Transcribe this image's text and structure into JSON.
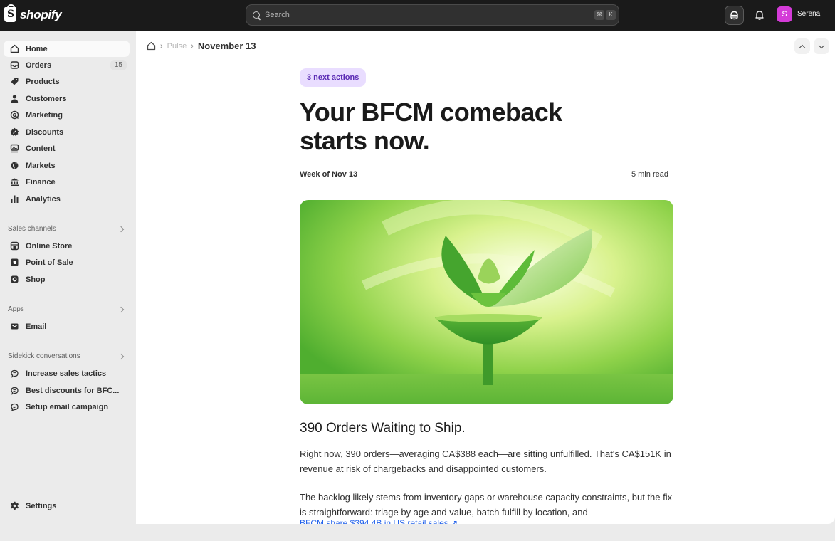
{
  "topbar": {
    "brand": "shopify",
    "search_placeholder": "Search",
    "shortcut_cmd": "⌘",
    "shortcut_key": "K",
    "user_initial": "S",
    "user_name": "Serena"
  },
  "sidebar": {
    "items": [
      {
        "label": "Home",
        "icon": "home-icon"
      },
      {
        "label": "Orders",
        "icon": "orders-icon",
        "badge": "15"
      },
      {
        "label": "Products",
        "icon": "tag-icon"
      },
      {
        "label": "Customers",
        "icon": "person-icon"
      },
      {
        "label": "Marketing",
        "icon": "target-icon"
      },
      {
        "label": "Discounts",
        "icon": "discount-icon"
      },
      {
        "label": "Content",
        "icon": "content-icon"
      },
      {
        "label": "Markets",
        "icon": "globe-icon"
      },
      {
        "label": "Finance",
        "icon": "bank-icon"
      },
      {
        "label": "Analytics",
        "icon": "bar-chart-icon"
      }
    ],
    "sales_channels": {
      "heading": "Sales channels",
      "items": [
        {
          "label": "Online Store",
          "icon": "store-icon"
        },
        {
          "label": "Point of Sale",
          "icon": "pos-icon"
        },
        {
          "label": "Shop",
          "icon": "shop-icon"
        }
      ]
    },
    "apps": {
      "heading": "Apps",
      "items": [
        {
          "label": "Email",
          "icon": "email-icon"
        }
      ]
    },
    "sidekick": {
      "heading": "Sidekick conversations",
      "items": [
        {
          "label": "Increase sales tactics",
          "icon": "chat-icon"
        },
        {
          "label": "Best discounts for BFC...",
          "icon": "chat-icon"
        },
        {
          "label": "Setup email campaign",
          "icon": "chat-icon"
        }
      ]
    },
    "settings_label": "Settings"
  },
  "breadcrumb": {
    "parent": "Pulse",
    "current": "November 13"
  },
  "article": {
    "pill": "3 next actions",
    "headline_line1": "Your BFCM comeback",
    "headline_line2": "starts now.",
    "week": "Week of Nov 13",
    "read_time": "5 min read",
    "section_title": "390 Orders Waiting to Ship.",
    "para1": "Right now, 390 orders—averaging CA$388 each—are sitting unfulfilled. That's CA$151K in revenue at risk of chargebacks and disappointed customers.",
    "para2": "The backlog likely stems from inventory gaps or warehouse capacity constraints, but the fix is straightforward: triage by age  and value, batch fulfill by location, and",
    "para3_partial": "BFCM share $394.4B in US retail sales ↗"
  },
  "colors": {
    "topbar": "#1a1a1a",
    "accent_purple": "#5b2bb4",
    "pill_bg": "#e9ddff",
    "avatar": "#d43bd8",
    "link": "#2463eb"
  }
}
